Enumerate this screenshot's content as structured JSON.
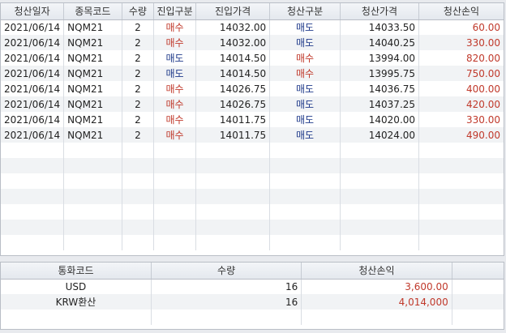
{
  "trades": {
    "headers": [
      "청산일자",
      "종목코드",
      "수량",
      "진입구분",
      "진입가격",
      "청산구분",
      "청산가격",
      "청산손익"
    ],
    "rows": [
      {
        "date": "2021/06/14",
        "code": "NQM21",
        "qty": "2",
        "entry_side": "매수",
        "entry_price": "14032.00",
        "exit_side": "매도",
        "exit_price": "14033.50",
        "pnl": "60.00"
      },
      {
        "date": "2021/06/14",
        "code": "NQM21",
        "qty": "2",
        "entry_side": "매수",
        "entry_price": "14032.00",
        "exit_side": "매도",
        "exit_price": "14040.25",
        "pnl": "330.00"
      },
      {
        "date": "2021/06/14",
        "code": "NQM21",
        "qty": "2",
        "entry_side": "매도",
        "entry_price": "14014.50",
        "exit_side": "매수",
        "exit_price": "13994.00",
        "pnl": "820.00"
      },
      {
        "date": "2021/06/14",
        "code": "NQM21",
        "qty": "2",
        "entry_side": "매도",
        "entry_price": "14014.50",
        "exit_side": "매수",
        "exit_price": "13995.75",
        "pnl": "750.00"
      },
      {
        "date": "2021/06/14",
        "code": "NQM21",
        "qty": "2",
        "entry_side": "매수",
        "entry_price": "14026.75",
        "exit_side": "매도",
        "exit_price": "14036.75",
        "pnl": "400.00"
      },
      {
        "date": "2021/06/14",
        "code": "NQM21",
        "qty": "2",
        "entry_side": "매수",
        "entry_price": "14026.75",
        "exit_side": "매도",
        "exit_price": "14037.25",
        "pnl": "420.00"
      },
      {
        "date": "2021/06/14",
        "code": "NQM21",
        "qty": "2",
        "entry_side": "매수",
        "entry_price": "14011.75",
        "exit_side": "매도",
        "exit_price": "14020.00",
        "pnl": "330.00"
      },
      {
        "date": "2021/06/14",
        "code": "NQM21",
        "qty": "2",
        "entry_side": "매수",
        "entry_price": "14011.75",
        "exit_side": "매도",
        "exit_price": "14024.00",
        "pnl": "490.00"
      }
    ]
  },
  "summary": {
    "headers": [
      "통화코드",
      "수량",
      "청산손익"
    ],
    "rows": [
      {
        "currency": "USD",
        "qty": "16",
        "pnl": "3,600.00"
      },
      {
        "currency": "KRW환산",
        "qty": "16",
        "pnl": "4,014,000"
      }
    ]
  },
  "colors": {
    "buy": "#c0392b",
    "sell": "#1f3a8a",
    "profit": "#c0392b"
  }
}
